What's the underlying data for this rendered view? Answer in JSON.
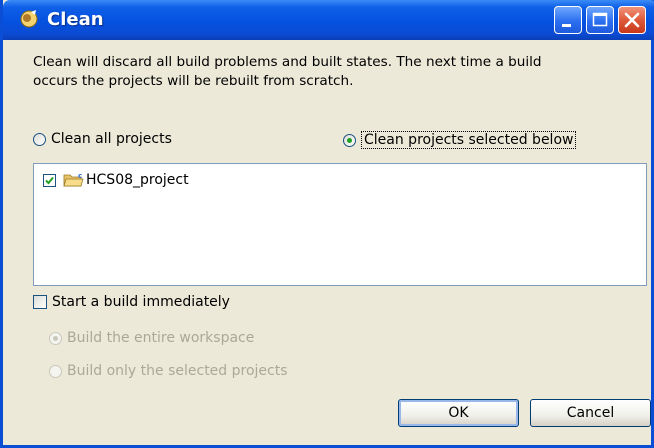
{
  "window": {
    "title": "Clean",
    "controls": {
      "minimize": "minimize-icon",
      "maximize": "maximize-icon",
      "close": "close-icon"
    },
    "colors": {
      "titlebar": "#0551e0",
      "face": "#ece9d8",
      "accent": "#21a121"
    }
  },
  "description": {
    "line1": "Clean will discard all build problems and built states.  The next time a build",
    "line2": "occurs the projects will be rebuilt from scratch."
  },
  "scope": {
    "all_label": "Clean all projects",
    "selected_label": "Clean projects selected below",
    "selected": "selected"
  },
  "projects": [
    {
      "name": "HCS08_project",
      "checked": true,
      "icon": "project-folder-icon"
    }
  ],
  "build_now": {
    "label": "Start a build immediately",
    "checked": false,
    "options": {
      "workspace_label": "Build the entire workspace",
      "selected_label": "Build only the selected projects",
      "selected": "workspace",
      "enabled": false
    }
  },
  "buttons": {
    "ok": "OK",
    "cancel": "Cancel"
  }
}
